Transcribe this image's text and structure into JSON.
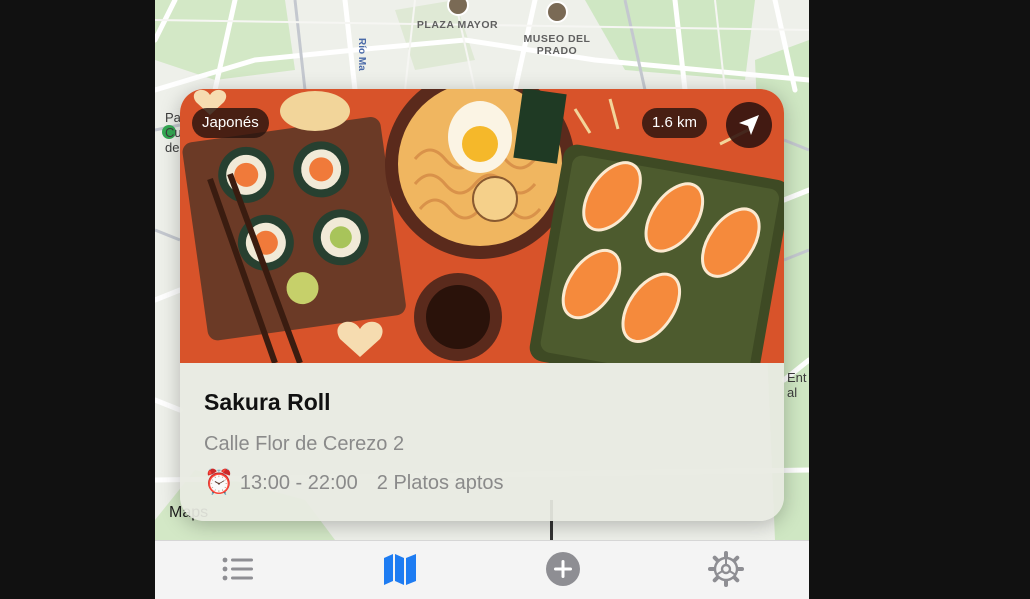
{
  "map": {
    "pois": [
      {
        "name": "plaza-mayor",
        "label": "PLAZA MAYOR"
      },
      {
        "name": "museo-del-prado",
        "label": "MUSEO DEL PRADO"
      }
    ],
    "street_label": "Río Ma",
    "left_edge_text": "Pa Cu de",
    "right_edge_text": "Ent al",
    "credit": "Maps",
    "colors": {
      "park": "#cfe7c3",
      "road": "#ffffff",
      "base": "#eef0ea",
      "water_label": "#4a6aa8"
    }
  },
  "card": {
    "cuisine_chip": "Japonés",
    "distance_chip": "1.6 km",
    "navigate_icon": "location-arrow-icon",
    "title": "Sakura Roll",
    "address": "Calle Flor de Cerezo 2",
    "alarm_icon": "⏰",
    "hours": "13:00 - 22:00",
    "dishes": "2 Platos aptos",
    "image_colors": {
      "background": "#d8532a",
      "board": "#6b3a26",
      "tray": "#4d5b2e"
    }
  },
  "tabbar": {
    "active_color": "#1e7cf2",
    "inactive_color": "#8e8e93",
    "tabs": [
      {
        "icon": "list-icon",
        "label": "",
        "active": false
      },
      {
        "icon": "map-icon",
        "label": "",
        "active": true
      },
      {
        "icon": "plus-circle-icon",
        "label": "",
        "active": false
      },
      {
        "icon": "gear-icon",
        "label": "",
        "active": false
      }
    ]
  }
}
